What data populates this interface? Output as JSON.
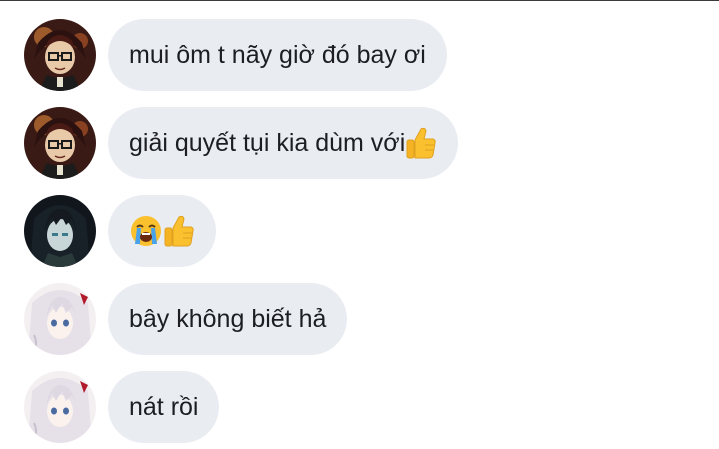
{
  "messages": [
    {
      "text": "mui ôm t nãy giờ đó bay ơi",
      "avatar": "avatar-red-haired-character",
      "emoji": []
    },
    {
      "text": "giải quyết tụi kia dùm với ",
      "avatar": "avatar-red-haired-character",
      "emoji": [
        "thumbs-up-icon"
      ]
    },
    {
      "text": "",
      "avatar": "avatar-dark-haired-character",
      "emoji": [
        "loudly-crying-face-icon",
        "thumbs-up-icon"
      ]
    },
    {
      "text": "bây không biết hả",
      "avatar": "avatar-white-haired-character",
      "emoji": []
    },
    {
      "text": "nát rồi",
      "avatar": "avatar-white-haired-character",
      "emoji": []
    }
  ],
  "colors": {
    "bubble_background": "#e9ecf1",
    "text": "#1c1e21",
    "emoji_yellow": "#fbc02d"
  }
}
